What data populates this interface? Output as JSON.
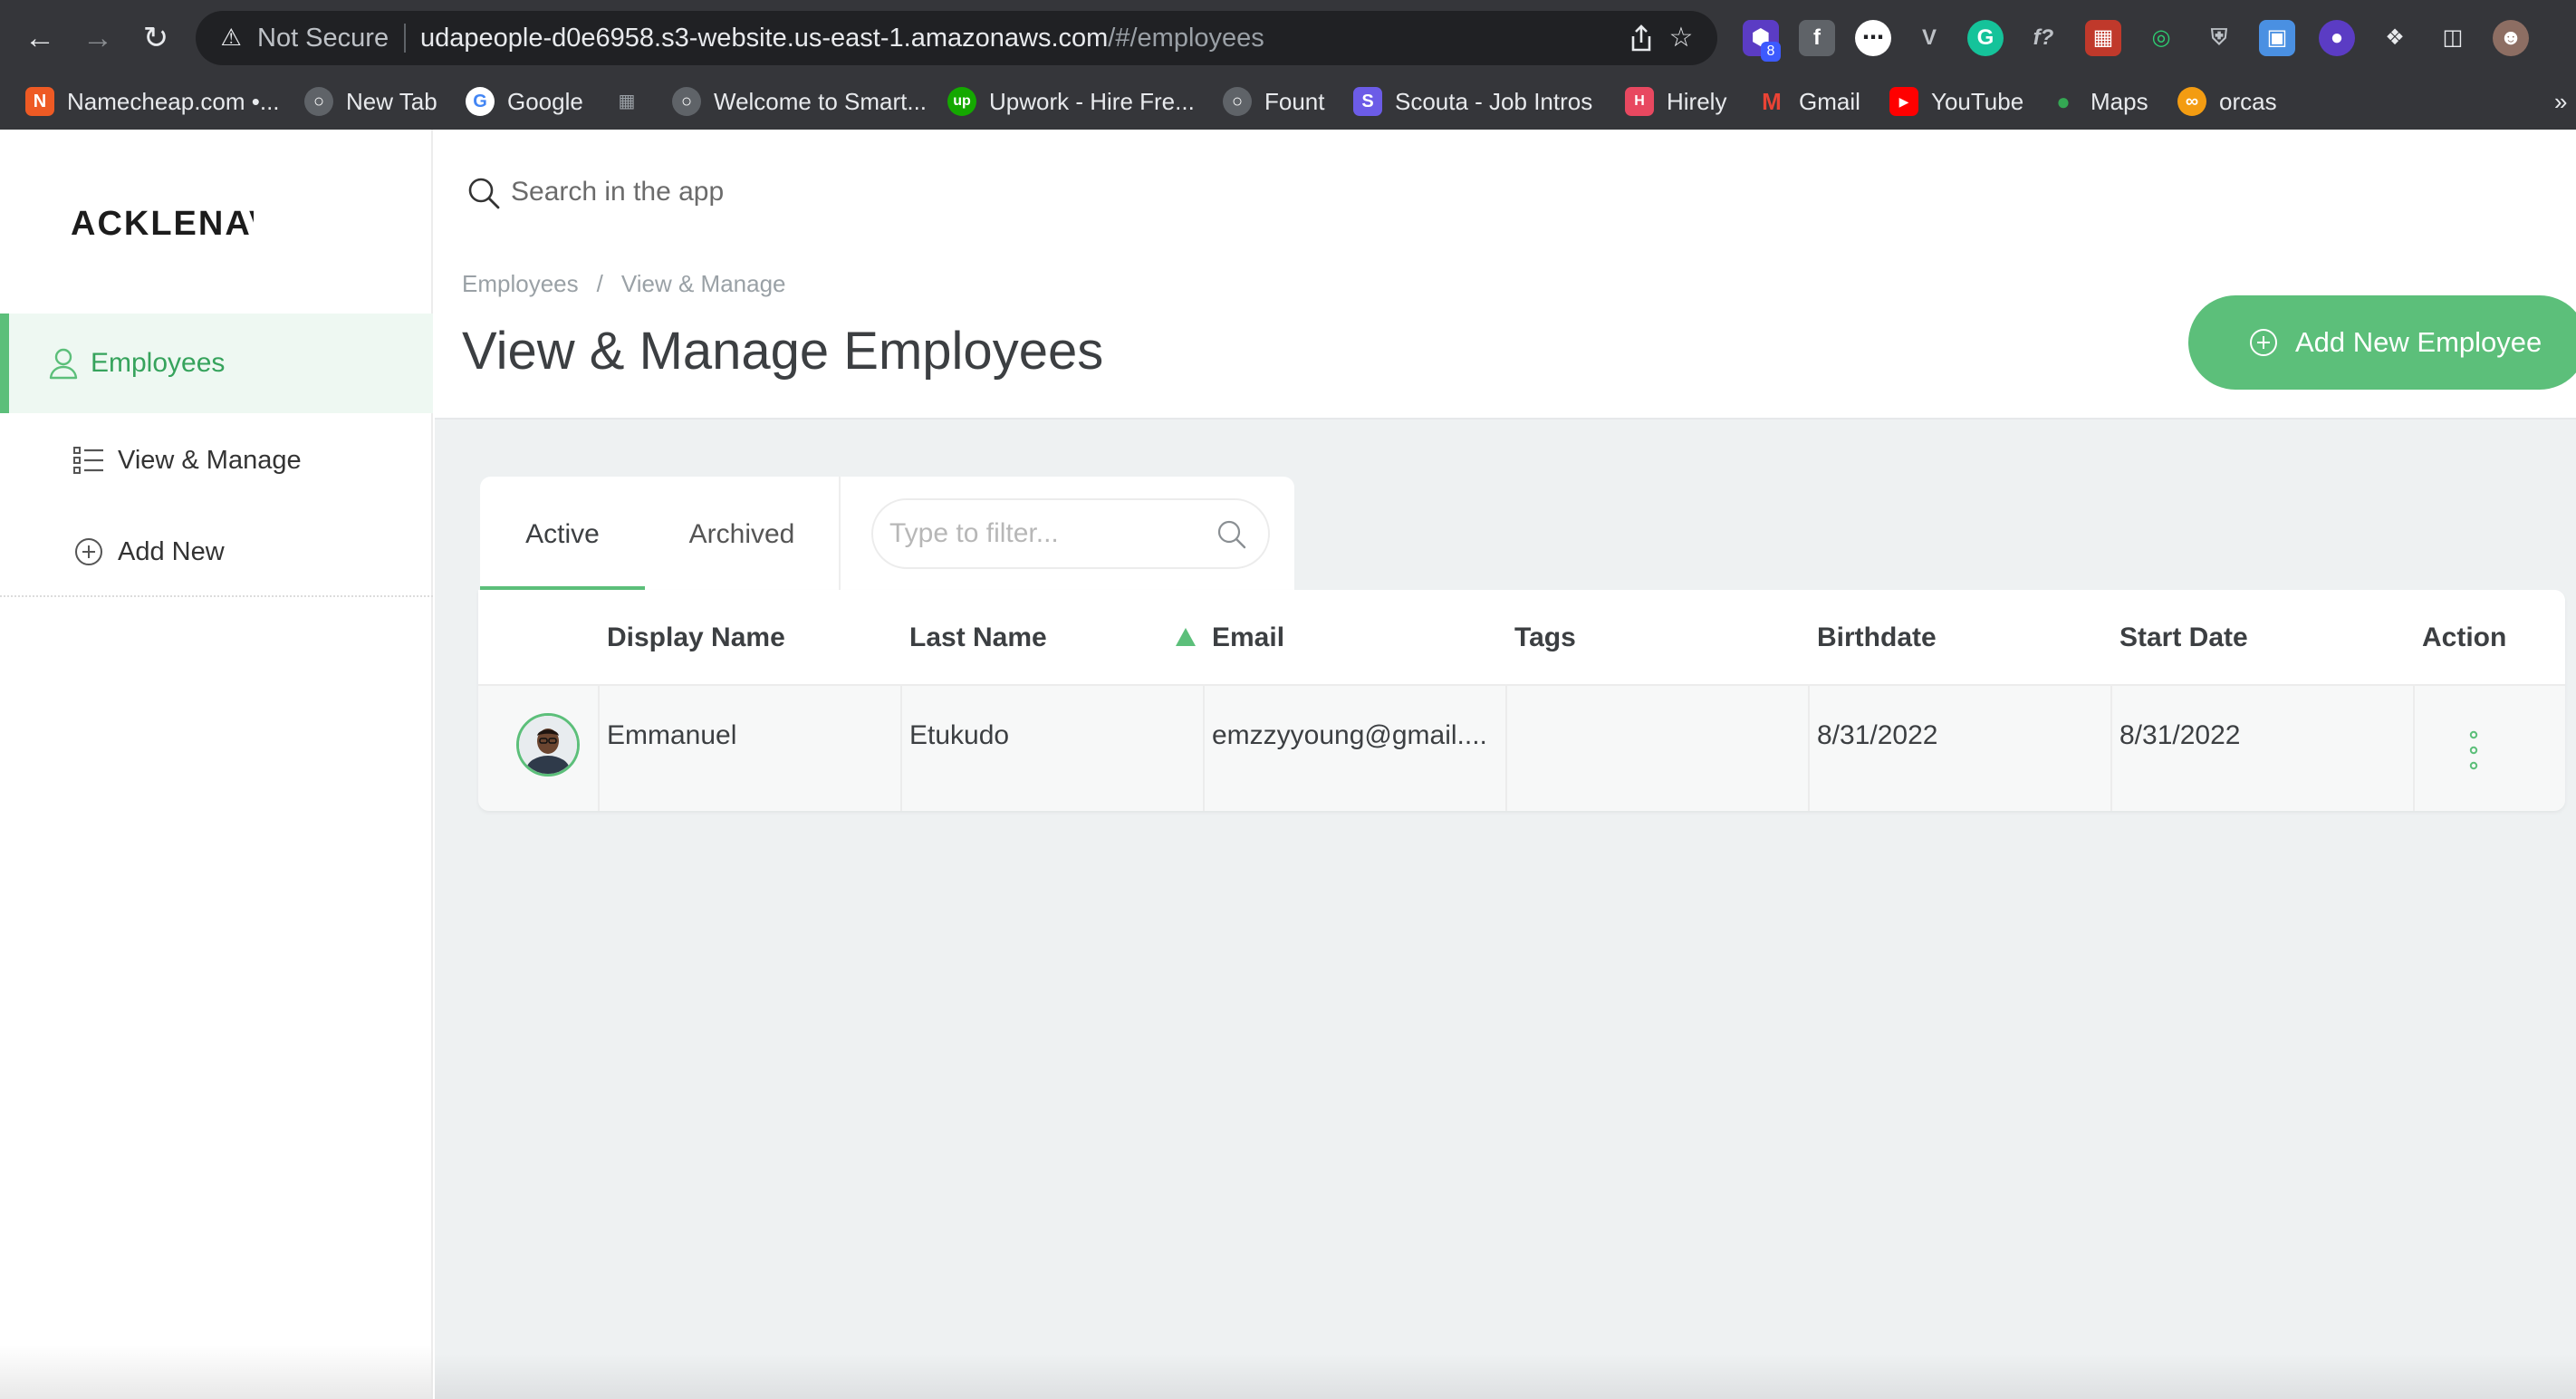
{
  "browser": {
    "security_label": "Not Secure",
    "url_host": "udapeople-d0e6958.s3-website.us-east-1.amazonaws.com",
    "url_path": "/#/employees",
    "extension_badge": "8",
    "bookmarks": [
      {
        "label": "Namecheap.com •...",
        "icon": "namecheap-icon",
        "color": "#ee5a24"
      },
      {
        "label": "New Tab",
        "icon": "globe-icon",
        "color": "#5f6368"
      },
      {
        "label": "Google",
        "icon": "google-icon",
        "color": "#ffffff"
      },
      {
        "label": "",
        "icon": "apps-grid-icon",
        "color": "#35363a"
      },
      {
        "label": "Welcome to Smart...",
        "icon": "globe-icon",
        "color": "#5f6368"
      },
      {
        "label": "Upwork - Hire Fre...",
        "icon": "upwork-icon",
        "color": "#14a800"
      },
      {
        "label": "Fount",
        "icon": "globe-icon",
        "color": "#5f6368"
      },
      {
        "label": "Scouta - Job Intros",
        "icon": "scouta-icon",
        "color": "#6c5ce7"
      },
      {
        "label": "Hirely",
        "icon": "hirely-icon",
        "color": "#e84860"
      },
      {
        "label": "Gmail",
        "icon": "gmail-icon",
        "color": "#ea4335"
      },
      {
        "label": "YouTube",
        "icon": "youtube-icon",
        "color": "#ff0000"
      },
      {
        "label": "Maps",
        "icon": "maps-pin-icon",
        "color": "#34a853"
      },
      {
        "label": "orcas",
        "icon": "orcas-icon",
        "color": "#f39c12"
      }
    ],
    "more_bookmarks": "»"
  },
  "app": {
    "logo_text": "ACKLENAVENUE",
    "accent_color": "#5cbf7a",
    "search": {
      "placeholder": "Search in the app"
    },
    "sidebar": {
      "section": {
        "label": "Employees",
        "icon": "user-icon"
      },
      "items": [
        {
          "label": "View & Manage",
          "icon": "list-icon"
        },
        {
          "label": "Add New",
          "icon": "plus-circle-icon"
        }
      ]
    },
    "breadcrumb": {
      "items": [
        "Employees",
        "View & Manage"
      ],
      "separator": "/"
    },
    "page_title": "View & Manage Employees",
    "add_button_label": "Add New Employee",
    "tabs": [
      {
        "label": "Active",
        "active": true
      },
      {
        "label": "Archived",
        "active": false
      }
    ],
    "filter": {
      "placeholder": "Type to filter..."
    },
    "table": {
      "columns": [
        "Display Name",
        "Last Name",
        "Email",
        "Tags",
        "Birthdate",
        "Start Date",
        "Action"
      ],
      "sorted_column": "Email",
      "sort_direction": "ascending",
      "rows": [
        {
          "display_name": "Emmanuel",
          "last_name": "Etukudo",
          "email": "emzzyyoung@gmail....",
          "tags": "",
          "birthdate": "8/31/2022",
          "start_date": "8/31/2022"
        }
      ]
    }
  }
}
